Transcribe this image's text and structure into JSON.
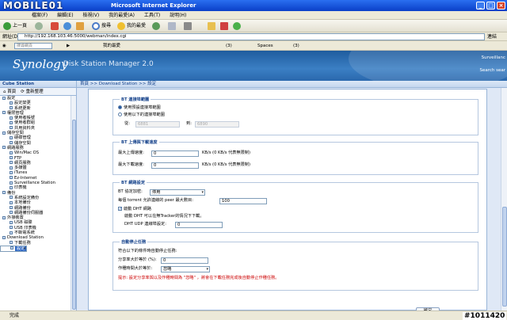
{
  "window": {
    "title": "Microsoft Internet Explorer",
    "watermark": "MOBILE01"
  },
  "menu": [
    "檔案(F)",
    "編輯(E)",
    "檢視(V)",
    "我的最愛(A)",
    "工具(T)",
    "說明(H)"
  ],
  "toolbar": {
    "back": "上一頁",
    "search": "搜尋",
    "favorites": "我的最愛"
  },
  "address": {
    "label": "網址(D)",
    "url": "http://192.168.103.46:5000/webman/index.cgi",
    "go": "連結"
  },
  "links": {
    "search_placeholder": "搜尋網頁",
    "favorites": "我的最愛",
    "item1": "(3)",
    "spaces": "Spaces",
    "item2": "(3)"
  },
  "dsm": {
    "logo": "Synology",
    "title": "Disk Station Manager 2.0",
    "right1": "Surveillanc",
    "right2": "Search sear"
  },
  "sidebar": {
    "header": "Cube Station",
    "tab_home": "首頁",
    "tab_reload": "重新整理",
    "items": [
      {
        "label": "設定",
        "level": 1,
        "selected": false
      },
      {
        "label": "設定變更",
        "level": 2,
        "selected": false
      },
      {
        "label": "系統更新",
        "level": 2,
        "selected": false
      },
      {
        "label": "權限管理",
        "level": 1,
        "selected": false
      },
      {
        "label": "使用者帳號",
        "level": 2,
        "selected": false
      },
      {
        "label": "使用者群組",
        "level": 2,
        "selected": false
      },
      {
        "label": "共用資料夾",
        "level": 2,
        "selected": false
      },
      {
        "label": "儲存空間",
        "level": 1,
        "selected": false
      },
      {
        "label": "硬碟管理",
        "level": 2,
        "selected": false
      },
      {
        "label": "儲存空間",
        "level": 2,
        "selected": false
      },
      {
        "label": "網路服務",
        "level": 1,
        "selected": false
      },
      {
        "label": "Win/Mac OS",
        "level": 2,
        "selected": false
      },
      {
        "label": "FTP",
        "level": 2,
        "selected": false
      },
      {
        "label": "網頁服務",
        "level": 2,
        "selected": false
      },
      {
        "label": "多媒體",
        "level": 2,
        "selected": false
      },
      {
        "label": "iTunes",
        "level": 2,
        "selected": false
      },
      {
        "label": "Ez-Internet",
        "level": 2,
        "selected": false
      },
      {
        "label": "Surveillance Station",
        "level": 2,
        "selected": false
      },
      {
        "label": "印表機",
        "level": 2,
        "selected": false
      },
      {
        "label": "備份",
        "level": 1,
        "selected": false
      },
      {
        "label": "系統設定備份",
        "level": 2,
        "selected": false
      },
      {
        "label": "本地備份",
        "level": 2,
        "selected": false
      },
      {
        "label": "網路備份",
        "level": 2,
        "selected": false
      },
      {
        "label": "網路備份伺服器",
        "level": 2,
        "selected": false
      },
      {
        "label": "外接裝置",
        "level": 1,
        "selected": false
      },
      {
        "label": "USB 磁碟",
        "level": 2,
        "selected": false
      },
      {
        "label": "USB 印表機",
        "level": 2,
        "selected": false
      },
      {
        "label": "不斷電系統",
        "level": 2,
        "selected": false
      },
      {
        "label": "Download Station",
        "level": 1,
        "selected": false
      },
      {
        "label": "下載任務",
        "level": 2,
        "selected": false
      },
      {
        "label": "設定",
        "level": 2,
        "selected": true
      }
    ]
  },
  "main": {
    "breadcrumb": "首頁 >> Download Station >> 設定",
    "port_section": {
      "legend": "BT 連接埠範圍",
      "opt_default": "使用預設連接埠範圍",
      "opt_custom": "使用以下的連接埠範圍",
      "from_label": "從:",
      "from_value": "6881",
      "to_label": "到:",
      "to_value": "6890"
    },
    "speed_section": {
      "legend": "BT 上傳與下載速度",
      "upload_label": "最大上傳速度:",
      "upload_value": "0",
      "upload_hint": "KB/s (0 KB/s 代表無限制)",
      "download_label": "最大下載速度:",
      "download_value": "0",
      "download_hint": "KB/s (0 KB/s 代表無限制)"
    },
    "network_section": {
      "legend": "BT 網路設定",
      "encrypt_label": "BT 協定加密:",
      "encrypt_value": "停用",
      "peers_label": "每個 torrent 允許連線的 peer 最大數目:",
      "peers_value": "100",
      "dht_label": "啟動 DHT 網路",
      "dht_desc": "啟動 DHT 可以在無Tracker的情況下下載。",
      "udp_label": "DHT UDP 連線埠設定:",
      "udp_value": "0"
    },
    "auto_stop_section": {
      "legend": "自動停止任務",
      "intro": "符合以下的條件時自動停止任務:",
      "ratio_label": "分享率大於等於 (%):",
      "ratio_value": "0",
      "time_label": "作種時間大於等於:",
      "time_value": "忽略",
      "tip": "提示: 設定分享率與以及作種時間為 \"忽略\" ，將會在下載任務完成後自動停止作種任務。"
    },
    "apply_button": "確定"
  },
  "status": {
    "text": "完成",
    "stamp": "#1011420"
  }
}
